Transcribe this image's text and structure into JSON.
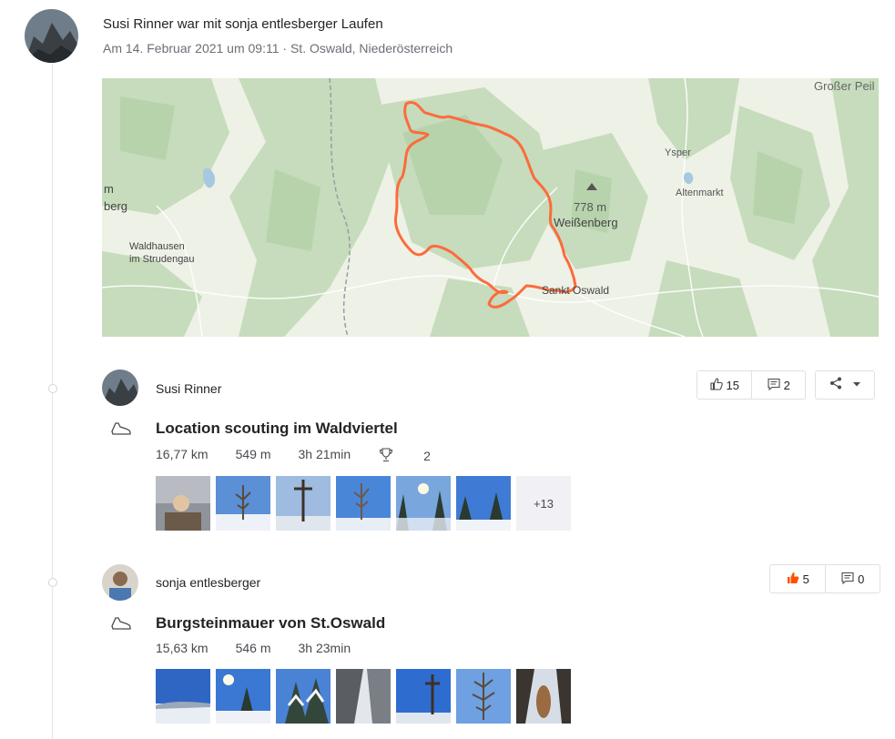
{
  "group": {
    "title": "Susi Rinner war mit sonja entlesberger Laufen",
    "subtitle": "Am 14. Februar 2021 um 09:11 · St. Oswald, Niederösterreich"
  },
  "map": {
    "labels": {
      "grosser_peil": "Großer Peil",
      "ysper": "Ysper",
      "altenmarkt": "Altenmarkt",
      "elevation": "778 m",
      "weissenberg": "Weißenberg",
      "sankt_oswald": "Sankt Oswald",
      "waldhausen": "Waldhausen",
      "strudengau": "im Strudengau",
      "edge_m": "m",
      "edge_berg": "berg"
    },
    "route_color": "#fc6b3c"
  },
  "activities": [
    {
      "athlete": "Susi Rinner",
      "title": "Location scouting im Waldviertel",
      "stats": {
        "distance": "16,77 km",
        "elevation": "549 m",
        "time": "3h 21min",
        "achievements": "2"
      },
      "kudos": "15",
      "comments": "2",
      "more_photos": "+13",
      "sport_icon": "shoe-icon"
    },
    {
      "athlete": "sonja entlesberger",
      "title": "Burgsteinmauer von St.Oswald",
      "stats": {
        "distance": "15,63 km",
        "elevation": "546 m",
        "time": "3h 23min"
      },
      "kudos": "5",
      "comments": "0",
      "sport_icon": "shoe-icon"
    }
  ],
  "colors": {
    "accent": "#fc5200",
    "text": "#242428",
    "muted": "#6d6d78"
  }
}
